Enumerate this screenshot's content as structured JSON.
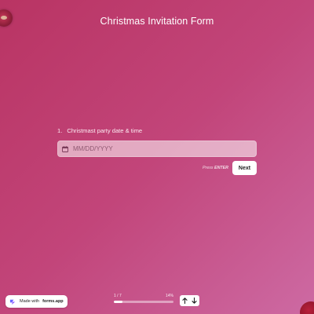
{
  "header": {
    "title": "Christmas Invitation Form"
  },
  "question": {
    "number": "1.",
    "label": "Christmast party date & time",
    "input_placeholder": "MM/DD/YYYY"
  },
  "actions": {
    "press_prefix": "Press",
    "press_key": "ENTER",
    "next_label": "Next"
  },
  "footer": {
    "made_with_prefix": "Made with",
    "made_with_brand": "forms.app"
  },
  "progress": {
    "step_text": "1 / 7",
    "percent_text": "14%",
    "fraction": 0.14
  },
  "icons": {
    "calendar": "calendar-icon",
    "up": "arrow-up-icon",
    "down": "arrow-down-icon",
    "logo": "forms-app-logo"
  },
  "colors": {
    "background_start": "#b93463",
    "background_end": "#cd6aa3",
    "button_bg": "#ffffff",
    "text": "#ffffff"
  }
}
